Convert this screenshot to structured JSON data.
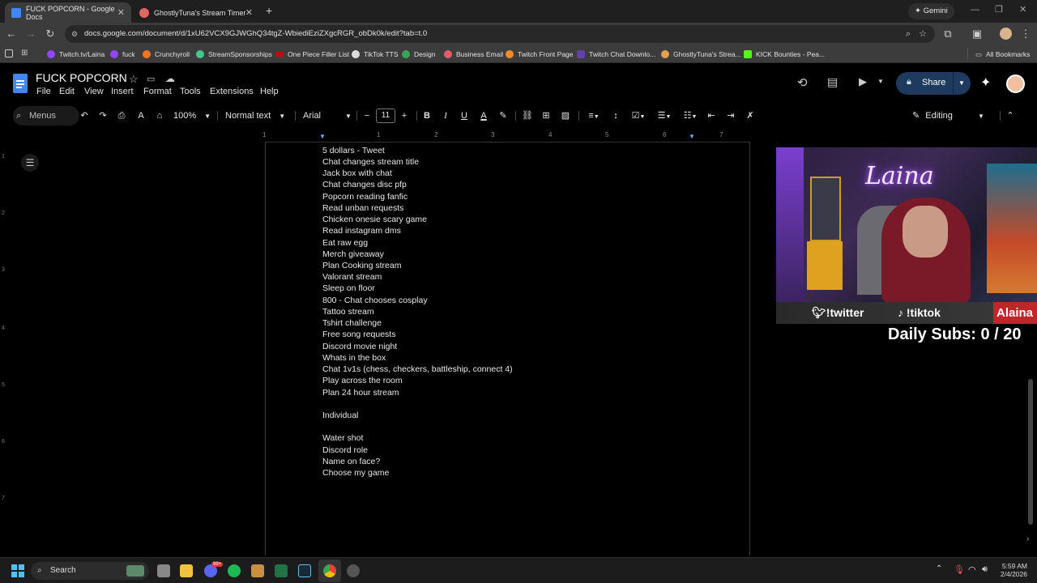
{
  "browser": {
    "tabs": [
      {
        "title": "FUCK POPCORN - Google Docs",
        "active": true
      },
      {
        "title": "GhostlyTuna's Stream Timer",
        "active": false
      }
    ],
    "gemini_label": "Gemini",
    "url": "docs.google.com/document/d/1xU62VCX9GJWGhQ34tgZ-WbiediEziZXgcRGR_obDk0k/edit?tab=t.0",
    "bookmarks": [
      "Twitch.tv/Laina",
      "fuck",
      "Crunchyroll",
      "StreamSponsorships",
      "One Piece Filler List",
      "TikTok TTS",
      "Design",
      "Business Email",
      "Twitch Front Page",
      "Twitch Chat Downlo...",
      "GhostlyTuna's Strea...",
      "KICK Bounties - Pea..."
    ],
    "all_bookmarks": "All Bookmarks"
  },
  "doc": {
    "title": "FUCK POPCORN",
    "menus": [
      "File",
      "Edit",
      "View",
      "Insert",
      "Format",
      "Tools",
      "Extensions",
      "Help"
    ],
    "share_label": "Share"
  },
  "toolbar": {
    "search_menus": "Menus",
    "zoom": "100%",
    "style": "Normal text",
    "font": "Arial",
    "font_size": "11",
    "editing": "Editing"
  },
  "ruler": {
    "numbers": [
      "1",
      "1",
      "2",
      "3",
      "4",
      "5",
      "6",
      "7"
    ],
    "left_numbers": [
      "1",
      "2",
      "3",
      "4",
      "5",
      "6",
      "7"
    ]
  },
  "body_lines": [
    "5 dollars - Tweet",
    "Chat changes stream title",
    "Jack box with chat",
    "Chat changes disc pfp",
    "Popcorn reading fanfic",
    "Read unban requests",
    "Chicken onesie scary game",
    "Read instagram dms",
    "Eat raw egg",
    "Merch giveaway",
    "Plan Cooking stream",
    "Valorant stream",
    "Sleep on floor",
    "800 - Chat chooses cosplay",
    "Tattoo stream",
    "Tshirt challenge",
    "Free song requests",
    "Discord movie night",
    "Whats in the box",
    "Chat 1v1s (chess, checkers, battleship, connect 4)",
    "Play across the room",
    "Plan 24 hour stream",
    "",
    "Individual",
    "",
    "Water shot",
    "Discord role",
    "Name on face?",
    "Choose my game"
  ],
  "stream_overlay": {
    "name_sign": "Laina",
    "twitter": "!twitter",
    "tiktok": "!tiktok",
    "name_tag": "Alaina",
    "daily_subs": "Daily Subs: 0 / 20"
  },
  "taskbar": {
    "search": "Search",
    "time": "5:59 AM",
    "date": "2/4/2026",
    "badge": "99+"
  },
  "colors": {
    "accent_blue": "#a8c7fa",
    "share_bg": "#1e3a5f",
    "docs_blue": "#4285f4"
  }
}
